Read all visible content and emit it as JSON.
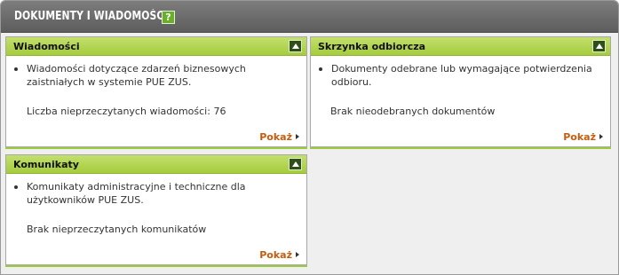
{
  "header": {
    "title": "DOKUMENTY I WIADOMOŚCI",
    "help_label": "?"
  },
  "panels": [
    {
      "title": "Wiadomości",
      "description": "Wiadomości dotyczące zdarzeń biznesowych zaistniałych w systemie PUE ZUS.",
      "status": "Liczba nieprzeczytanych wiadomości: 76",
      "link": "Pokaż"
    },
    {
      "title": "Skrzynka odbiorcza",
      "description": "Dokumenty odebrane lub wymagające potwierdzenia odbioru.",
      "status": "Brak nieodebranych dokumentów",
      "link": "Pokaż"
    },
    {
      "title": "Komunikaty",
      "description": "Komunikaty administracyjne i techniczne dla użytkowników PUE ZUS.",
      "status": "Brak nieprzeczytanych komunikatów",
      "link": "Pokaż"
    }
  ],
  "colors": {
    "accent_green": "#a5cc3d",
    "link_orange": "#c65c0e",
    "header_gray": "#6b6b6b"
  },
  "icons": {
    "help": "help-icon",
    "collapse": "collapse-arrow-up-icon",
    "link_arrow": "arrow-right-icon"
  }
}
